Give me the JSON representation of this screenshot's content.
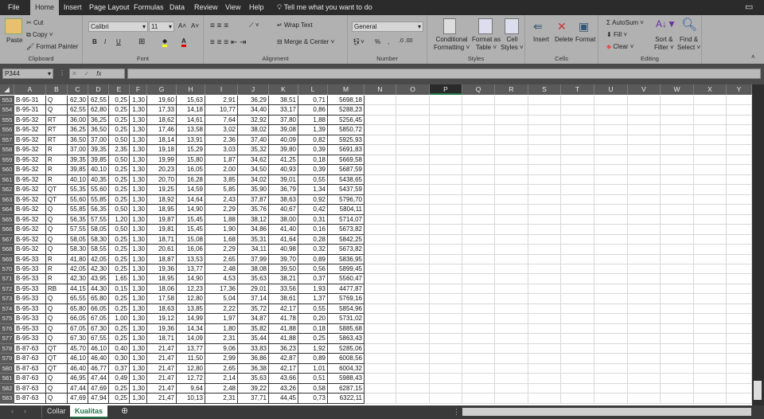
{
  "menu": {
    "tabs": [
      "File",
      "Home",
      "Insert",
      "Page Layout",
      "Formulas",
      "Data",
      "Review",
      "View",
      "Help"
    ],
    "active": "Home",
    "tell_me": "Tell me what you want to do"
  },
  "ribbon": {
    "clipboard": {
      "paste": "Paste",
      "cut": "Cut",
      "copy": "Copy",
      "format_painter": "Format Painter",
      "label": "Clipboard"
    },
    "font": {
      "name": "Calibri",
      "size": "11",
      "bold": "B",
      "italic": "I",
      "underline": "U",
      "label": "Font"
    },
    "alignment": {
      "wrap": "Wrap Text",
      "merge": "Merge & Center",
      "label": "Alignment"
    },
    "number": {
      "format": "General",
      "percent": "%",
      "comma": ",",
      "label": "Number"
    },
    "styles": {
      "conditional": "Conditional",
      "conditional2": "Formatting",
      "format_as": "Format as",
      "table": "Table",
      "cell": "Cell",
      "styles": "Styles",
      "label": "Styles"
    },
    "cells": {
      "insert": "Insert",
      "delete": "Delete",
      "format": "Format",
      "label": "Cells"
    },
    "editing": {
      "autosum": "AutoSum",
      "fill": "Fill",
      "clear": "Clear",
      "sort": "Sort &",
      "filter": "Filter",
      "find": "Find &",
      "select": "Select",
      "label": "Editing"
    }
  },
  "formula_bar": {
    "name_box": "P344",
    "fx": "fx",
    "value": ""
  },
  "columns": [
    "A",
    "B",
    "C",
    "D",
    "E",
    "F",
    "G",
    "H",
    "I",
    "J",
    "K",
    "L",
    "M",
    "N",
    "O",
    "P",
    "Q",
    "R",
    "S",
    "T",
    "U",
    "V",
    "W",
    "X",
    "Y"
  ],
  "selected_column": "P",
  "rows": [
    [
      "553",
      "B-95-31",
      "Q",
      "62,30",
      "62,55",
      "0,25",
      "1,30",
      "19,60",
      "15,63",
      "2,91",
      "36,29",
      "38,51",
      "0,71",
      "5698,18"
    ],
    [
      "554",
      "B-95-31",
      "Q",
      "62,55",
      "62,80",
      "0,25",
      "1,30",
      "17,33",
      "14,18",
      "10,77",
      "34,40",
      "33,17",
      "0,86",
      "5288,23"
    ],
    [
      "555",
      "B-95-32",
      "RT",
      "36,00",
      "36,25",
      "0,25",
      "1,30",
      "18,62",
      "14,61",
      "7,64",
      "32,92",
      "37,80",
      "1,88",
      "5256,45"
    ],
    [
      "556",
      "B-95-32",
      "RT",
      "36,25",
      "36,50",
      "0,25",
      "1,30",
      "17,46",
      "13,58",
      "3,02",
      "38,02",
      "39,08",
      "1,39",
      "5850,72"
    ],
    [
      "557",
      "B-95-32",
      "RT",
      "36,50",
      "37,00",
      "0,50",
      "1,30",
      "18,14",
      "13,91",
      "2,36",
      "37,40",
      "40,09",
      "0,82",
      "5925,93"
    ],
    [
      "558",
      "B-95-32",
      "R",
      "37,00",
      "39,35",
      "2,35",
      "1,30",
      "19,18",
      "15,29",
      "3,03",
      "35,32",
      "39,80",
      "0,39",
      "5691,83"
    ],
    [
      "559",
      "B-95-32",
      "R",
      "39,35",
      "39,85",
      "0,50",
      "1,30",
      "19,99",
      "15,80",
      "1,87",
      "34,62",
      "41,25",
      "0,18",
      "5669,58"
    ],
    [
      "560",
      "B-95-32",
      "R",
      "39,85",
      "40,10",
      "0,25",
      "1,30",
      "20,23",
      "16,05",
      "2,00",
      "34,50",
      "40,93",
      "0,39",
      "5687,59"
    ],
    [
      "561",
      "B-95-32",
      "R",
      "40,10",
      "40,35",
      "0,25",
      "1,30",
      "20,70",
      "16,28",
      "3,85",
      "34,02",
      "39,01",
      "0,55",
      "5438,65"
    ],
    [
      "562",
      "B-95-32",
      "QT",
      "55,35",
      "55,60",
      "0,25",
      "1,30",
      "19,25",
      "14,59",
      "5,85",
      "35,90",
      "36,79",
      "1,34",
      "5437,59"
    ],
    [
      "563",
      "B-95-32",
      "QT",
      "55,60",
      "55,85",
      "0,25",
      "1,30",
      "18,92",
      "14,64",
      "2,43",
      "37,87",
      "38,63",
      "0,92",
      "5796,70"
    ],
    [
      "564",
      "B-95-32",
      "Q",
      "55,85",
      "56,35",
      "0,50",
      "1,30",
      "18,95",
      "14,90",
      "2,29",
      "35,76",
      "40,67",
      "0,42",
      "5804,11"
    ],
    [
      "565",
      "B-95-32",
      "Q",
      "56,35",
      "57,55",
      "1,20",
      "1,30",
      "19,87",
      "15,45",
      "1,88",
      "38,12",
      "38,00",
      "0,31",
      "5714,07"
    ],
    [
      "566",
      "B-95-32",
      "Q",
      "57,55",
      "58,05",
      "0,50",
      "1,30",
      "19,81",
      "15,45",
      "1,90",
      "34,86",
      "41,40",
      "0,16",
      "5673,82"
    ],
    [
      "567",
      "B-95-32",
      "Q",
      "58,05",
      "58,30",
      "0,25",
      "1,30",
      "18,71",
      "15,08",
      "1,68",
      "35,31",
      "41,64",
      "0,28",
      "5842,25"
    ],
    [
      "568",
      "B-95-32",
      "Q",
      "58,30",
      "58,55",
      "0,25",
      "1,30",
      "20,61",
      "16,06",
      "2,29",
      "34,11",
      "40,98",
      "0,32",
      "5673,82"
    ],
    [
      "569",
      "B-95-33",
      "R",
      "41,80",
      "42,05",
      "0,25",
      "1,30",
      "18,87",
      "13,53",
      "2,65",
      "37,99",
      "39,70",
      "0,89",
      "5836,95"
    ],
    [
      "570",
      "B-95-33",
      "R",
      "42,05",
      "42,30",
      "0,25",
      "1,30",
      "19,36",
      "13,77",
      "2,48",
      "38,08",
      "39,50",
      "0,56",
      "5899,45"
    ],
    [
      "571",
      "B-95-33",
      "R",
      "42,30",
      "43,95",
      "1,65",
      "1,30",
      "18,95",
      "14,90",
      "4,53",
      "35,63",
      "38,21",
      "0,37",
      "5560,47"
    ],
    [
      "572",
      "B-95-33",
      "RB",
      "44,15",
      "44,30",
      "0,15",
      "1,30",
      "18,06",
      "12,23",
      "17,36",
      "29,01",
      "33,56",
      "1,93",
      "4477,87"
    ],
    [
      "573",
      "B-95-33",
      "Q",
      "65,55",
      "65,80",
      "0,25",
      "1,30",
      "17,58",
      "12,80",
      "5,04",
      "37,14",
      "38,61",
      "1,37",
      "5769,16"
    ],
    [
      "574",
      "B-95-33",
      "Q",
      "65,80",
      "66,05",
      "0,25",
      "1,30",
      "18,63",
      "13,85",
      "2,22",
      "35,72",
      "42,17",
      "0,55",
      "5854,96"
    ],
    [
      "575",
      "B-95-33",
      "Q",
      "66,05",
      "67,05",
      "1,00",
      "1,30",
      "19,12",
      "14,99",
      "1,97",
      "34,87",
      "41,78",
      "0,20",
      "5731,02"
    ],
    [
      "576",
      "B-95-33",
      "Q",
      "67,05",
      "67,30",
      "0,25",
      "1,30",
      "19,36",
      "14,34",
      "1,80",
      "35,82",
      "41,88",
      "0,18",
      "5885,68"
    ],
    [
      "577",
      "B-95-33",
      "Q",
      "67,30",
      "67,55",
      "0,25",
      "1,30",
      "18,71",
      "14,09",
      "2,31",
      "35,44",
      "41,88",
      "0,25",
      "5863,43"
    ],
    [
      "578",
      "B-87-63",
      "QT",
      "45,70",
      "46,10",
      "0,40",
      "1,30",
      "21,47",
      "13,77",
      "9,06",
      "33,83",
      "36,23",
      "1,92",
      "5285,06"
    ],
    [
      "579",
      "B-87-63",
      "QT",
      "46,10",
      "46,40",
      "0,30",
      "1,30",
      "21,47",
      "11,50",
      "2,99",
      "36,86",
      "42,87",
      "0,89",
      "6008,56"
    ],
    [
      "580",
      "B-87-63",
      "QT",
      "46,40",
      "46,77",
      "0,37",
      "1,30",
      "21,47",
      "12,80",
      "2,65",
      "36,38",
      "42,17",
      "1,01",
      "6004,32"
    ],
    [
      "581",
      "B-87-63",
      "Q",
      "46,95",
      "47,44",
      "0,49",
      "1,30",
      "21,47",
      "12,72",
      "2,14",
      "35,63",
      "43,66",
      "0,51",
      "5988,43"
    ],
    [
      "582",
      "B-87-63",
      "Q",
      "47,44",
      "47,69",
      "0,25",
      "1,30",
      "21,47",
      "9,64",
      "2,48",
      "39,22",
      "43,26",
      "0,58",
      "6287,15"
    ],
    [
      "583",
      "B-87-63",
      "Q",
      "47,69",
      "47,94",
      "0,25",
      "1,30",
      "21,47",
      "10,13",
      "2,31",
      "37,71",
      "44,45",
      "0,73",
      "6322,11"
    ]
  ],
  "sheets": [
    "Collar",
    "Kualitas"
  ],
  "active_sheet": "Kualitas",
  "colors": {
    "accent": "#217346",
    "ribbon": "#b1b1b1",
    "dark": "#2b2b2b"
  }
}
